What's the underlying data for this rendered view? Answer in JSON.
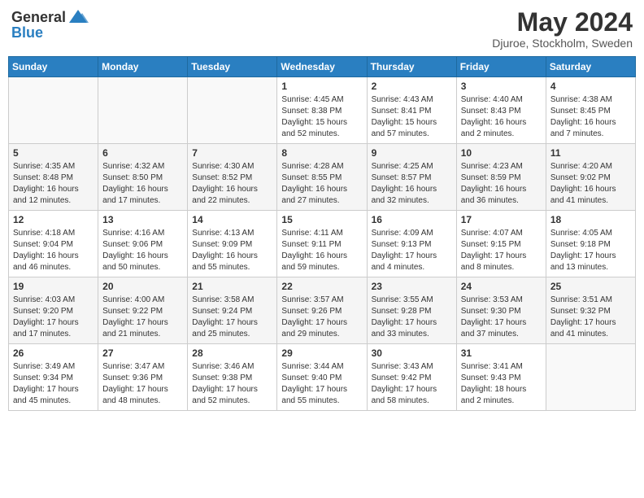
{
  "header": {
    "logo_line1": "General",
    "logo_line2": "Blue",
    "month_year": "May 2024",
    "location": "Djuroe, Stockholm, Sweden"
  },
  "days_of_week": [
    "Sunday",
    "Monday",
    "Tuesday",
    "Wednesday",
    "Thursday",
    "Friday",
    "Saturday"
  ],
  "weeks": [
    [
      {
        "day": "",
        "info": ""
      },
      {
        "day": "",
        "info": ""
      },
      {
        "day": "",
        "info": ""
      },
      {
        "day": "1",
        "info": "Sunrise: 4:45 AM\nSunset: 8:38 PM\nDaylight: 15 hours\nand 52 minutes."
      },
      {
        "day": "2",
        "info": "Sunrise: 4:43 AM\nSunset: 8:41 PM\nDaylight: 15 hours\nand 57 minutes."
      },
      {
        "day": "3",
        "info": "Sunrise: 4:40 AM\nSunset: 8:43 PM\nDaylight: 16 hours\nand 2 minutes."
      },
      {
        "day": "4",
        "info": "Sunrise: 4:38 AM\nSunset: 8:45 PM\nDaylight: 16 hours\nand 7 minutes."
      }
    ],
    [
      {
        "day": "5",
        "info": "Sunrise: 4:35 AM\nSunset: 8:48 PM\nDaylight: 16 hours\nand 12 minutes."
      },
      {
        "day": "6",
        "info": "Sunrise: 4:32 AM\nSunset: 8:50 PM\nDaylight: 16 hours\nand 17 minutes."
      },
      {
        "day": "7",
        "info": "Sunrise: 4:30 AM\nSunset: 8:52 PM\nDaylight: 16 hours\nand 22 minutes."
      },
      {
        "day": "8",
        "info": "Sunrise: 4:28 AM\nSunset: 8:55 PM\nDaylight: 16 hours\nand 27 minutes."
      },
      {
        "day": "9",
        "info": "Sunrise: 4:25 AM\nSunset: 8:57 PM\nDaylight: 16 hours\nand 32 minutes."
      },
      {
        "day": "10",
        "info": "Sunrise: 4:23 AM\nSunset: 8:59 PM\nDaylight: 16 hours\nand 36 minutes."
      },
      {
        "day": "11",
        "info": "Sunrise: 4:20 AM\nSunset: 9:02 PM\nDaylight: 16 hours\nand 41 minutes."
      }
    ],
    [
      {
        "day": "12",
        "info": "Sunrise: 4:18 AM\nSunset: 9:04 PM\nDaylight: 16 hours\nand 46 minutes."
      },
      {
        "day": "13",
        "info": "Sunrise: 4:16 AM\nSunset: 9:06 PM\nDaylight: 16 hours\nand 50 minutes."
      },
      {
        "day": "14",
        "info": "Sunrise: 4:13 AM\nSunset: 9:09 PM\nDaylight: 16 hours\nand 55 minutes."
      },
      {
        "day": "15",
        "info": "Sunrise: 4:11 AM\nSunset: 9:11 PM\nDaylight: 16 hours\nand 59 minutes."
      },
      {
        "day": "16",
        "info": "Sunrise: 4:09 AM\nSunset: 9:13 PM\nDaylight: 17 hours\nand 4 minutes."
      },
      {
        "day": "17",
        "info": "Sunrise: 4:07 AM\nSunset: 9:15 PM\nDaylight: 17 hours\nand 8 minutes."
      },
      {
        "day": "18",
        "info": "Sunrise: 4:05 AM\nSunset: 9:18 PM\nDaylight: 17 hours\nand 13 minutes."
      }
    ],
    [
      {
        "day": "19",
        "info": "Sunrise: 4:03 AM\nSunset: 9:20 PM\nDaylight: 17 hours\nand 17 minutes."
      },
      {
        "day": "20",
        "info": "Sunrise: 4:00 AM\nSunset: 9:22 PM\nDaylight: 17 hours\nand 21 minutes."
      },
      {
        "day": "21",
        "info": "Sunrise: 3:58 AM\nSunset: 9:24 PM\nDaylight: 17 hours\nand 25 minutes."
      },
      {
        "day": "22",
        "info": "Sunrise: 3:57 AM\nSunset: 9:26 PM\nDaylight: 17 hours\nand 29 minutes."
      },
      {
        "day": "23",
        "info": "Sunrise: 3:55 AM\nSunset: 9:28 PM\nDaylight: 17 hours\nand 33 minutes."
      },
      {
        "day": "24",
        "info": "Sunrise: 3:53 AM\nSunset: 9:30 PM\nDaylight: 17 hours\nand 37 minutes."
      },
      {
        "day": "25",
        "info": "Sunrise: 3:51 AM\nSunset: 9:32 PM\nDaylight: 17 hours\nand 41 minutes."
      }
    ],
    [
      {
        "day": "26",
        "info": "Sunrise: 3:49 AM\nSunset: 9:34 PM\nDaylight: 17 hours\nand 45 minutes."
      },
      {
        "day": "27",
        "info": "Sunrise: 3:47 AM\nSunset: 9:36 PM\nDaylight: 17 hours\nand 48 minutes."
      },
      {
        "day": "28",
        "info": "Sunrise: 3:46 AM\nSunset: 9:38 PM\nDaylight: 17 hours\nand 52 minutes."
      },
      {
        "day": "29",
        "info": "Sunrise: 3:44 AM\nSunset: 9:40 PM\nDaylight: 17 hours\nand 55 minutes."
      },
      {
        "day": "30",
        "info": "Sunrise: 3:43 AM\nSunset: 9:42 PM\nDaylight: 17 hours\nand 58 minutes."
      },
      {
        "day": "31",
        "info": "Sunrise: 3:41 AM\nSunset: 9:43 PM\nDaylight: 18 hours\nand 2 minutes."
      },
      {
        "day": "",
        "info": ""
      }
    ]
  ]
}
